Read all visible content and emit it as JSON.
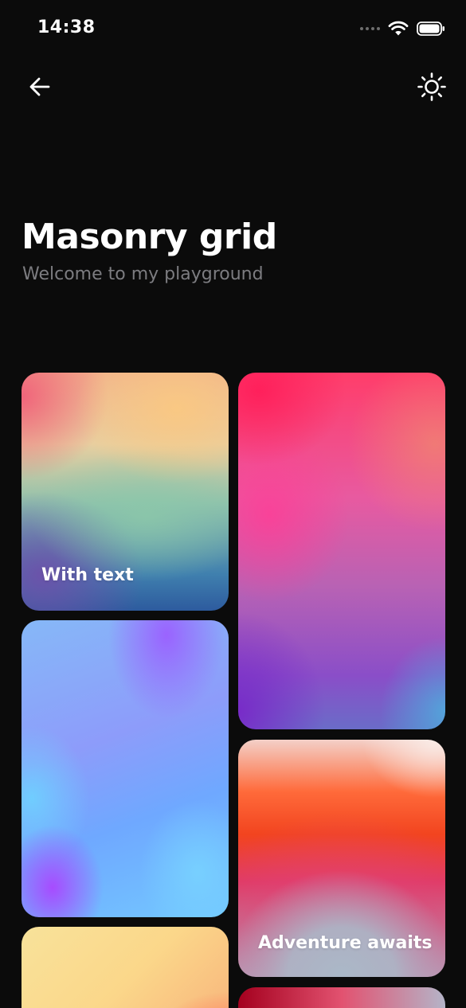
{
  "status_bar": {
    "time": "14:38"
  },
  "nav": {
    "back_icon": "arrow-left-icon",
    "theme_icon": "sun-icon"
  },
  "header": {
    "title": "Masonry grid",
    "subtitle": "Welcome to my playground"
  },
  "cards": [
    {
      "label": "With text",
      "icon": null
    },
    {
      "label": ""
    },
    {
      "label": ""
    },
    {
      "label": "Adventure awaits"
    },
    {
      "label": ""
    },
    {
      "label": ""
    }
  ],
  "colors": {
    "background": "#0b0b0b",
    "title": "#ffffff",
    "subtitle": "#7c7c80"
  }
}
